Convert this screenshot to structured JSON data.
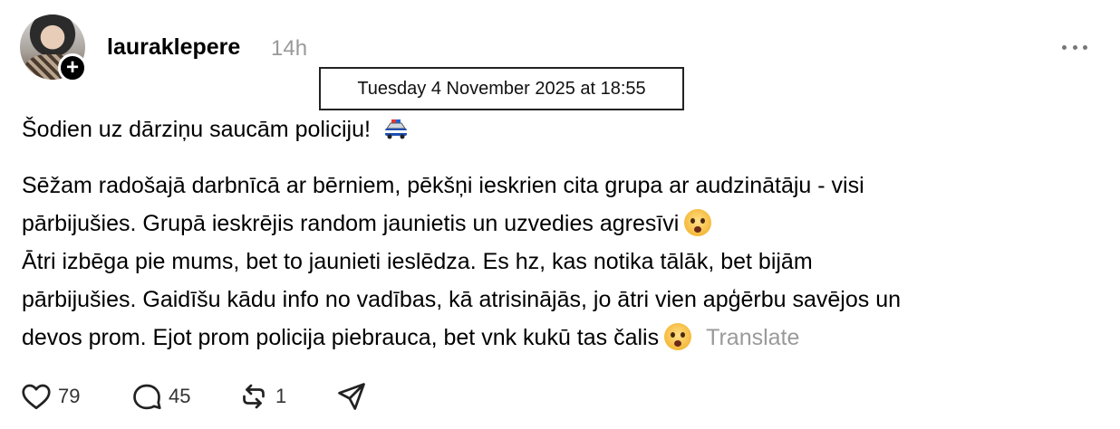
{
  "post": {
    "username": "lauraklepere",
    "time_ago": "14h",
    "timestamp_tooltip": "Tuesday 4 November 2025 at 18:55",
    "line1": "Šodien uz dārziņu saucām policiju!",
    "para2_line1": "Sēžam radošajā darbnīcā ar bērniem, pēkšņi ieskrien cita grupa ar audzinātāju - visi",
    "para2_line2": "pārbijušies. Grupā ieskrējis random jaunietis un uzvedies agresīvi",
    "para2_line3": "Ātri izbēga pie mums, bet to jaunieti ieslēdza. Es hz, kas notika tālāk, bet bijām",
    "para2_line4": "pārbijušies. Gaidīšu kādu info no vadības, kā atrisinājās, jo ātri vien apģērbu savējos un",
    "para2_line5": "devos prom. Ejot prom policija piebrauca, bet vnk kukū tas čalis",
    "translate_label": "Translate"
  },
  "actions": {
    "likes": "79",
    "replies": "45",
    "reposts": "1"
  },
  "icons": {
    "like": "heart-icon",
    "reply": "comment-bubble-icon",
    "repost": "repost-icon",
    "share": "send-icon",
    "more": "more-dots-icon",
    "follow": "plus-icon",
    "emoji_car": "police-car-emoji",
    "emoji_face": "flushed-face-emoji"
  }
}
